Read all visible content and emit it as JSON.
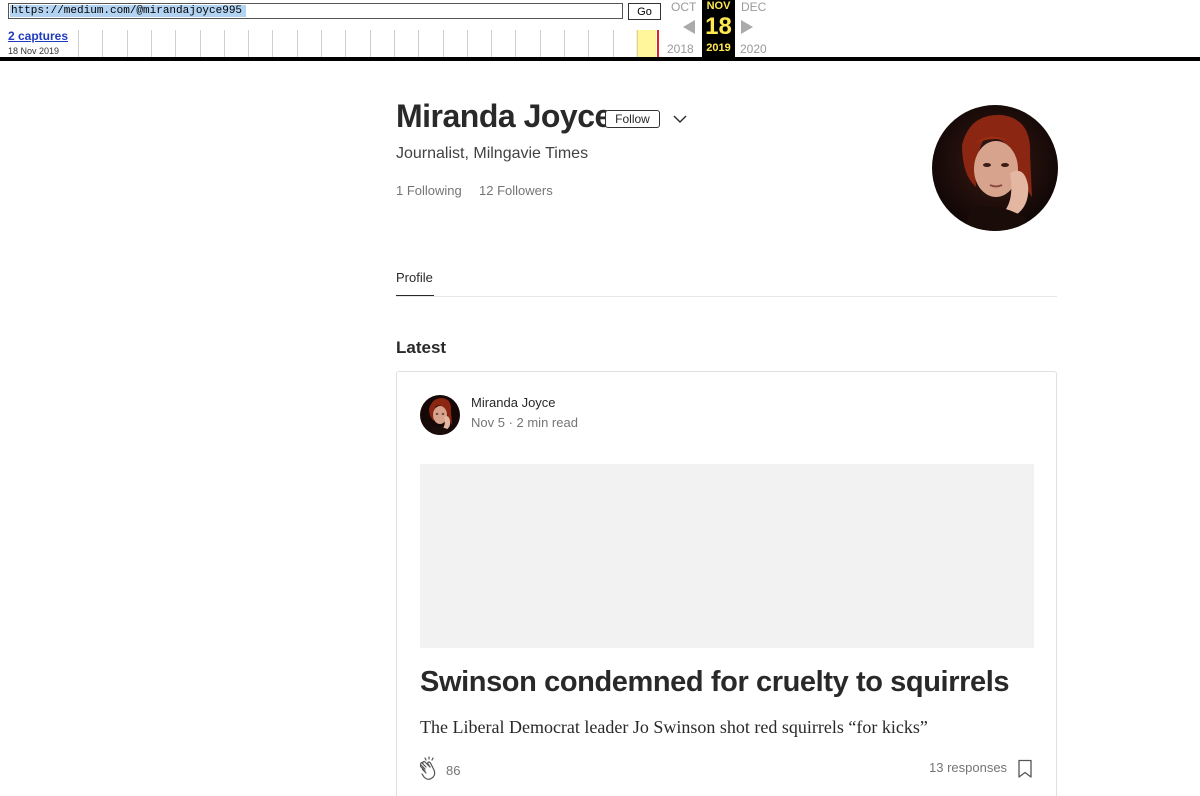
{
  "wayback": {
    "url": "https://medium.com/@mirandajoyce995",
    "go_label": "Go",
    "captures_label": "2 captures",
    "capture_date": "18 Nov 2019",
    "prev_month": "OCT",
    "current_month": "NOV",
    "next_month": "DEC",
    "current_day": "18",
    "prev_year": "2018",
    "current_year": "2019",
    "next_year": "2020",
    "colors": {
      "calendar_bg": "#000000",
      "calendar_text": "#ffe84f",
      "capture_marker": "#e0241b",
      "capture_highlight": "#fff59a"
    }
  },
  "profile": {
    "name": "Miranda Joyce",
    "follow_label": "Follow",
    "bio": "Journalist, Milngavie Times",
    "following": "1 Following",
    "followers": "12 Followers",
    "avatar_icon": "author-photo"
  },
  "tabs": [
    {
      "label": "Profile",
      "active": true
    }
  ],
  "latest_heading": "Latest",
  "post": {
    "author": "Miranda Joyce",
    "meta": "Nov 5 · 2 min read",
    "title": "Swinson condemned for cruelty to squirrels",
    "subtitle": "The Liberal Democrat leader Jo Swinson shot red squirrels “for kicks”",
    "claps": "86",
    "responses": "13 responses",
    "clap_icon": "clap-icon",
    "bookmark_icon": "bookmark-icon"
  }
}
